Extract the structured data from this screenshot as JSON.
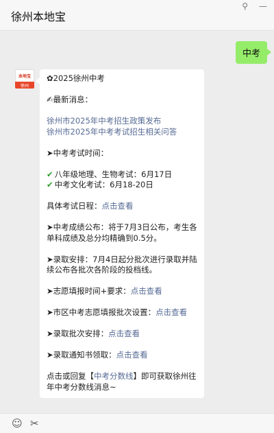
{
  "window": {
    "title": "徐州本地宝",
    "pin_icon": "pin-icon",
    "minimize_icon": "minimize-icon"
  },
  "sent_message": {
    "text": "中考"
  },
  "avatar": {
    "top_text": "本地宝",
    "bottom_text": "徐州"
  },
  "reply": {
    "header": "✿2025徐州中考",
    "news_heading": "✍最新消息：",
    "news_links": [
      "徐州市2025年中考招生政策发布",
      "徐州市2025年中考考试招生相关问答"
    ],
    "exam_time_heading": "➤中考考试时间：",
    "exam_items": [
      "八年级地理、生物考试：6月17日",
      "中考文化考试：6月18-20日"
    ],
    "schedule_label": "具体考试日程：",
    "schedule_link": "点击查看",
    "results_text": "➤中考成绩公布：将于7月3日公布，考生各单科成绩及总分均精确到0.5分。",
    "admission_text": "➤录取安排：7月4日起分批次进行录取并陆续公布各批次各阶段的投档线。",
    "volunteer_label": "➤志愿填报时间+要求：",
    "volunteer_link": "点击查看",
    "district_label": "➤市区中考志愿填报批次设置：",
    "district_link": "点击查看",
    "batch_label": "➤录取批次安排：",
    "batch_link": "点击查看",
    "notice_label": "➤录取通知书领取：",
    "notice_link": "点击查看",
    "footer_prefix": "点击或回复【",
    "footer_link": "中考分数线",
    "footer_suffix": "】即可获取徐州往年中考分数线消息~"
  },
  "toolbar": {
    "emoji_icon": "emoji-icon",
    "scissors_icon": "scissors-icon"
  }
}
